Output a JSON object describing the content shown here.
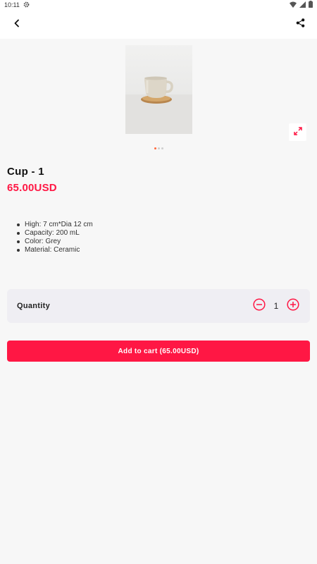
{
  "status_bar": {
    "time": "10:11",
    "icons": [
      "gear-icon",
      "wifi-icon",
      "cellular-icon",
      "battery-icon"
    ]
  },
  "app_bar": {
    "back_icon": "chevron-left-icon",
    "share_icon": "share-icon"
  },
  "gallery": {
    "image_count": 3,
    "active_index": 0,
    "expand_icon": "expand-icon"
  },
  "product": {
    "title": "Cup - 1",
    "price": "65.00USD",
    "details": [
      "High: 7 cm*Dia 12 cm",
      "Capacity: 200 mL",
      "Color: Grey",
      "Material: Ceramic"
    ]
  },
  "quantity": {
    "label": "Quantity",
    "value": "1",
    "minus_icon": "minus-circle-icon",
    "plus_icon": "plus-circle-icon"
  },
  "cart": {
    "button_label": "Add to cart (65.00USD)"
  },
  "colors": {
    "accent": "#ff1744",
    "background": "#f7f7f7",
    "card": "#efeef3"
  }
}
